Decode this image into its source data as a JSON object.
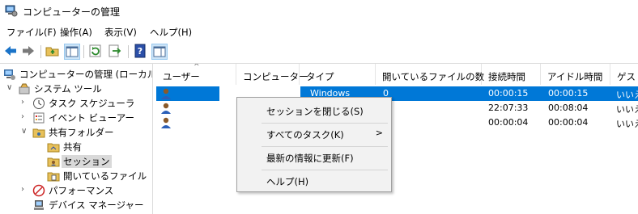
{
  "window": {
    "title": "コンピューターの管理"
  },
  "menu": [
    "ファイル(F)",
    "操作(A)",
    "表示(V)",
    "ヘルプ(H)"
  ],
  "toolbar": [
    "back-icon",
    "forward-icon",
    "up-folder-icon",
    "show-hide-tree-icon",
    "refresh-icon",
    "export-icon",
    "help-icon",
    "properties-pane-icon"
  ],
  "tree": [
    {
      "label": "コンピューターの管理 (ローカル)",
      "icon": "computer-management-icon"
    },
    {
      "label": "システム ツール",
      "icon": "tools-icon",
      "expanded": true
    },
    {
      "label": "タスク スケジューラ",
      "icon": "clock-icon"
    },
    {
      "label": "イベント ビューアー",
      "icon": "event-viewer-icon"
    },
    {
      "label": "共有フォルダー",
      "icon": "shared-folders-icon",
      "expanded": true
    },
    {
      "label": "共有",
      "icon": "shares-icon"
    },
    {
      "label": "セッション",
      "icon": "sessions-icon",
      "selected": true
    },
    {
      "label": "開いているファイル",
      "icon": "open-files-icon"
    },
    {
      "label": "パフォーマンス",
      "icon": "performance-icon"
    },
    {
      "label": "デバイス マネージャー",
      "icon": "device-manager-icon"
    }
  ],
  "table": {
    "sort_indicator": "^",
    "columns": [
      "ユーザー",
      "コンピューター",
      "タイプ",
      "開いているファイルの数",
      "接続時間",
      "アイドル時間",
      "ゲスト"
    ],
    "rows": [
      {
        "user": "",
        "computer": "w",
        "computer_suffix": "...",
        "type": "Windows",
        "open_files": "0",
        "connected": "00:00:15",
        "idle": "00:00:15",
        "guest": "いいえ",
        "selected": true
      },
      {
        "user": "",
        "computer": "",
        "computer_suffix": "",
        "type": "",
        "open_files": "",
        "connected": "22:07:33",
        "idle": "00:08:04",
        "guest": "いいえ",
        "selected": false
      },
      {
        "user": "",
        "computer": "",
        "computer_suffix": "",
        "type": "",
        "open_files": "",
        "connected": "00:00:04",
        "idle": "00:00:04",
        "guest": "いいえ",
        "selected": false
      }
    ]
  },
  "context_menu": {
    "items": [
      {
        "label": "セッションを閉じる(S)"
      },
      {
        "label": "すべてのタスク(K)",
        "submenu_arrow": ">"
      },
      {
        "label": "最新の情報に更新(F)"
      },
      {
        "label": "ヘルプ(H)"
      }
    ]
  }
}
